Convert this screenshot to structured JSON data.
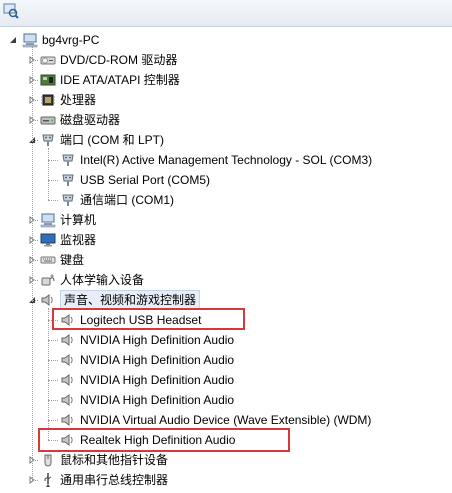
{
  "toolbar": {
    "refresh_icon": "scan-hardware-icon"
  },
  "tree": {
    "root": {
      "label": "bg4vrg-PC",
      "icon": "computer-icon"
    },
    "categories": [
      {
        "label": "DVD/CD-ROM 驱动器",
        "icon": "dvd-drive-icon",
        "expanded": false
      },
      {
        "label": "IDE ATA/ATAPI 控制器",
        "icon": "ide-controller-icon",
        "expanded": false
      },
      {
        "label": "处理器",
        "icon": "processor-icon",
        "expanded": false
      },
      {
        "label": "磁盘驱动器",
        "icon": "disk-drive-icon",
        "expanded": false
      },
      {
        "label": "端口 (COM 和 LPT)",
        "icon": "port-icon",
        "expanded": true,
        "children": [
          "Intel(R) Active Management Technology - SOL (COM3)",
          "USB Serial Port (COM5)",
          "通信端口 (COM1)"
        ]
      },
      {
        "label": "计算机",
        "icon": "computer-icon",
        "expanded": false
      },
      {
        "label": "监视器",
        "icon": "monitor-icon",
        "expanded": false
      },
      {
        "label": "键盘",
        "icon": "keyboard-icon",
        "expanded": false
      },
      {
        "label": "人体学输入设备",
        "icon": "hid-icon",
        "expanded": false
      },
      {
        "label": "声音、视频和游戏控制器",
        "icon": "speaker-icon",
        "expanded": true,
        "selected": true,
        "children": [
          "Logitech USB Headset",
          "NVIDIA High Definition Audio",
          "NVIDIA High Definition Audio",
          "NVIDIA High Definition Audio",
          "NVIDIA High Definition Audio",
          "NVIDIA Virtual Audio Device (Wave Extensible) (WDM)",
          "Realtek High Definition Audio"
        ]
      },
      {
        "label": "鼠标和其他指针设备",
        "icon": "mouse-icon",
        "expanded": false
      },
      {
        "label": "通用串行总线控制器",
        "icon": "usb-icon",
        "expanded": false
      }
    ]
  },
  "highlight_color": "#d8383a"
}
